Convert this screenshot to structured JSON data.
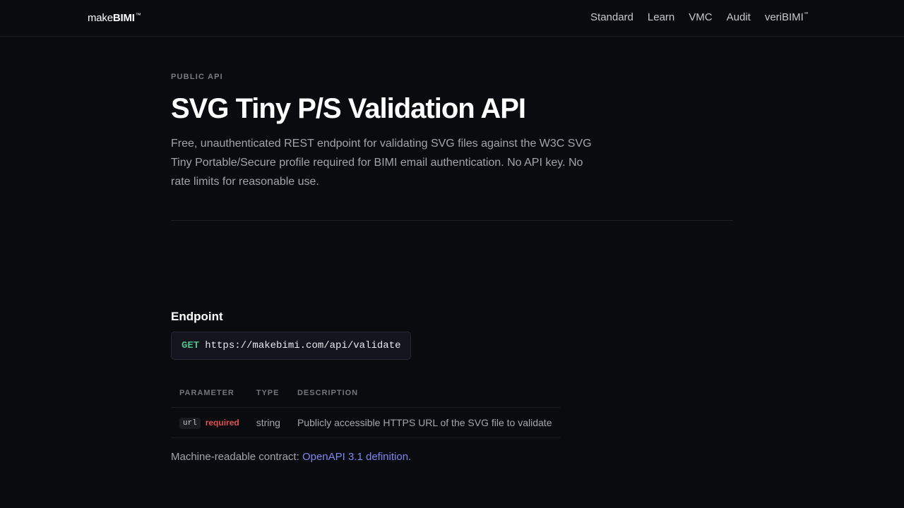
{
  "header": {
    "brand_prefix": "make",
    "brand_bold": "BIMI",
    "brand_mark": "™",
    "nav": [
      {
        "label": "Standard"
      },
      {
        "label": "Learn"
      },
      {
        "label": "VMC"
      },
      {
        "label": "Audit"
      },
      {
        "label": "veriBIMI",
        "mark": "℠"
      }
    ]
  },
  "hero": {
    "eyebrow": "PUBLIC API",
    "title": "SVG Tiny P/S Validation API",
    "description": "Free, unauthenticated REST endpoint for validating SVG files against the W3C SVG Tiny Portable/Secure profile required for BIMI email authentication. No API key. No rate limits for reasonable use."
  },
  "endpoint": {
    "heading": "Endpoint",
    "method": "GET",
    "url": "https://makebimi.com/api/validate"
  },
  "params_table": {
    "headers": [
      "PARAMETER",
      "TYPE",
      "DESCRIPTION"
    ],
    "rows": [
      {
        "name": "url",
        "required_label": "required",
        "type": "string",
        "description": "Publicly accessible HTTPS URL of the SVG file to validate"
      }
    ]
  },
  "contract": {
    "prefix": "Machine-readable contract: ",
    "link_text": "OpenAPI 3.1 definition",
    "suffix": "."
  },
  "colors": {
    "background": "#0a0b0e",
    "method_green": "#4fbf8a",
    "required_red": "#e25050",
    "link_blue": "#7f86f0"
  }
}
